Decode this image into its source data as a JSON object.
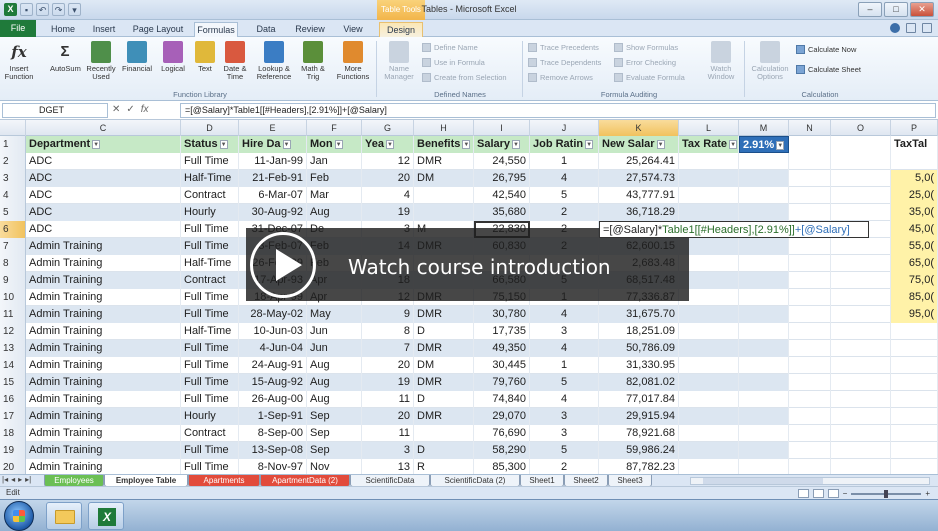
{
  "window": {
    "title": "Tables - Microsoft Excel",
    "context_tab_header": "Table Tools"
  },
  "tabs": [
    "File",
    "Home",
    "Insert",
    "Page Layout",
    "Formulas",
    "Data",
    "Review",
    "View",
    "Design"
  ],
  "active_tab": "Formulas",
  "ribbon": {
    "function_library": {
      "label": "Function Library",
      "buttons": [
        "Insert Function",
        "AutoSum",
        "Recently Used",
        "Financial",
        "Logical",
        "Text",
        "Date & Time",
        "Lookup & Reference",
        "Math & Trig",
        "More Functions"
      ]
    },
    "defined_names": {
      "label": "Defined Names",
      "name_manager": "Name Manager",
      "items": [
        "Define Name",
        "Use in Formula",
        "Create from Selection"
      ]
    },
    "formula_auditing": {
      "label": "Formula Auditing",
      "items": [
        "Trace Precedents",
        "Trace Dependents",
        "Remove Arrows",
        "Show Formulas",
        "Error Checking",
        "Evaluate Formula"
      ],
      "watch_window": "Watch Window"
    },
    "calculation": {
      "label": "Calculation",
      "options": "Calculation Options",
      "items": [
        "Calculate Now",
        "Calculate Sheet"
      ]
    }
  },
  "formula_bar": {
    "name_box": "DGET",
    "formula": "=[@Salary]*Table1[[#Headers],[2.91%]]+[@Salary]"
  },
  "columns": [
    "C",
    "D",
    "E",
    "F",
    "G",
    "H",
    "I",
    "J",
    "K",
    "L",
    "M",
    "N",
    "O",
    "P"
  ],
  "headers": {
    "department": "Department",
    "status": "Status",
    "hire_date": "Hire Da",
    "month": "Mon",
    "years": "Yea",
    "benefits": "Benefits",
    "salary": "Salary",
    "job_rating": "Job Ratin",
    "new_salary": "New Salar",
    "tax_rate": "Tax Rate",
    "pct": "2.91%",
    "taxtable": "TaxTal"
  },
  "rows": [
    {
      "n": "2",
      "dept": "ADC",
      "status": "Full Time",
      "hire": "11-Jan-99",
      "mon": "Jan",
      "yrs": "12",
      "ben": "DMR",
      "sal": "24,550",
      "rate": "1",
      "newsal": "25,264.41",
      "p": ""
    },
    {
      "n": "3",
      "dept": "ADC",
      "status": "Half-Time",
      "hire": "21-Feb-91",
      "mon": "Feb",
      "yrs": "20",
      "ben": "DM",
      "sal": "26,795",
      "rate": "4",
      "newsal": "27,574.73",
      "p": "5,0("
    },
    {
      "n": "4",
      "dept": "ADC",
      "status": "Contract",
      "hire": "6-Mar-07",
      "mon": "Mar",
      "yrs": "4",
      "ben": "",
      "sal": "42,540",
      "rate": "5",
      "newsal": "43,777.91",
      "p": "25,0("
    },
    {
      "n": "5",
      "dept": "ADC",
      "status": "Hourly",
      "hire": "30-Aug-92",
      "mon": "Aug",
      "yrs": "19",
      "ben": "",
      "sal": "35,680",
      "rate": "2",
      "newsal": "36,718.29",
      "p": "35,0("
    },
    {
      "n": "6",
      "dept": "ADC",
      "status": "Full Time",
      "hire": "31-Dec-07",
      "mon": "De",
      "yrs": "3",
      "ben": "M",
      "sal": "22,830",
      "rate": "2",
      "newsal": "",
      "p": "45,0("
    },
    {
      "n": "7",
      "dept": "Admin Training",
      "status": "Full Time",
      "hire": "3-Feb-07",
      "mon": "Feb",
      "yrs": "14",
      "ben": "DMR",
      "sal": "60,830",
      "rate": "2",
      "newsal": "62,600.15",
      "p": "55,0("
    },
    {
      "n": "8",
      "dept": "Admin Training",
      "status": "Half-Time",
      "hire": "26-Feb-99",
      "mon": "Feb",
      "yrs": "",
      "ben": "",
      "sal": "",
      "rate": "",
      "newsal": "2,683.48",
      "p": "65,0("
    },
    {
      "n": "9",
      "dept": "Admin Training",
      "status": "Contract",
      "hire": "17-Apr-93",
      "mon": "Apr",
      "yrs": "18",
      "ben": "",
      "sal": "66,580",
      "rate": "5",
      "newsal": "68,517.48",
      "p": "75,0("
    },
    {
      "n": "10",
      "dept": "Admin Training",
      "status": "Full Time",
      "hire": "18-Apr-99",
      "mon": "Apr",
      "yrs": "12",
      "ben": "DMR",
      "sal": "75,150",
      "rate": "1",
      "newsal": "77,336.87",
      "p": "85,0("
    },
    {
      "n": "11",
      "dept": "Admin Training",
      "status": "Full Time",
      "hire": "28-May-02",
      "mon": "May",
      "yrs": "9",
      "ben": "DMR",
      "sal": "30,780",
      "rate": "4",
      "newsal": "31,675.70",
      "p": "95,0("
    },
    {
      "n": "12",
      "dept": "Admin Training",
      "status": "Half-Time",
      "hire": "10-Jun-03",
      "mon": "Jun",
      "yrs": "8",
      "ben": "D",
      "sal": "17,735",
      "rate": "3",
      "newsal": "18,251.09",
      "p": ""
    },
    {
      "n": "13",
      "dept": "Admin Training",
      "status": "Full Time",
      "hire": "4-Jun-04",
      "mon": "Jun",
      "yrs": "7",
      "ben": "DMR",
      "sal": "49,350",
      "rate": "4",
      "newsal": "50,786.09",
      "p": ""
    },
    {
      "n": "14",
      "dept": "Admin Training",
      "status": "Full Time",
      "hire": "24-Aug-91",
      "mon": "Aug",
      "yrs": "20",
      "ben": "DM",
      "sal": "30,445",
      "rate": "1",
      "newsal": "31,330.95",
      "p": ""
    },
    {
      "n": "15",
      "dept": "Admin Training",
      "status": "Full Time",
      "hire": "15-Aug-92",
      "mon": "Aug",
      "yrs": "19",
      "ben": "DMR",
      "sal": "79,760",
      "rate": "5",
      "newsal": "82,081.02",
      "p": ""
    },
    {
      "n": "16",
      "dept": "Admin Training",
      "status": "Full Time",
      "hire": "26-Aug-00",
      "mon": "Aug",
      "yrs": "11",
      "ben": "D",
      "sal": "74,840",
      "rate": "4",
      "newsal": "77,017.84",
      "p": ""
    },
    {
      "n": "17",
      "dept": "Admin Training",
      "status": "Hourly",
      "hire": "1-Sep-91",
      "mon": "Sep",
      "yrs": "20",
      "ben": "DMR",
      "sal": "29,070",
      "rate": "3",
      "newsal": "29,915.94",
      "p": ""
    },
    {
      "n": "18",
      "dept": "Admin Training",
      "status": "Contract",
      "hire": "8-Sep-00",
      "mon": "Sep",
      "yrs": "11",
      "ben": "",
      "sal": "76,690",
      "rate": "3",
      "newsal": "78,921.68",
      "p": ""
    },
    {
      "n": "19",
      "dept": "Admin Training",
      "status": "Full Time",
      "hire": "13-Sep-08",
      "mon": "Sep",
      "yrs": "3",
      "ben": "D",
      "sal": "58,290",
      "rate": "5",
      "newsal": "59,986.24",
      "p": ""
    },
    {
      "n": "20",
      "dept": "Admin Training",
      "status": "Full Time",
      "hire": "8-Nov-97",
      "mon": "Nov",
      "yrs": "13",
      "ben": "R",
      "sal": "85,300",
      "rate": "2",
      "newsal": "87,782.23",
      "p": ""
    }
  ],
  "active_cell_formula": {
    "prefix": "=[@Salary]*",
    "table_ref": "Table1[[#Headers],[2.91%]]",
    "suffix": "+[@Salary]"
  },
  "sheet_tabs": [
    "Employees",
    "Employee Table",
    "Apartments",
    "ApartmentData (2)",
    "ScientificData",
    "ScientificData (2)",
    "Sheet1",
    "Sheet2",
    "Sheet3"
  ],
  "active_sheet": "Employee Table",
  "status": {
    "mode": "Edit"
  },
  "overlay": {
    "text": "Watch course introduction"
  }
}
